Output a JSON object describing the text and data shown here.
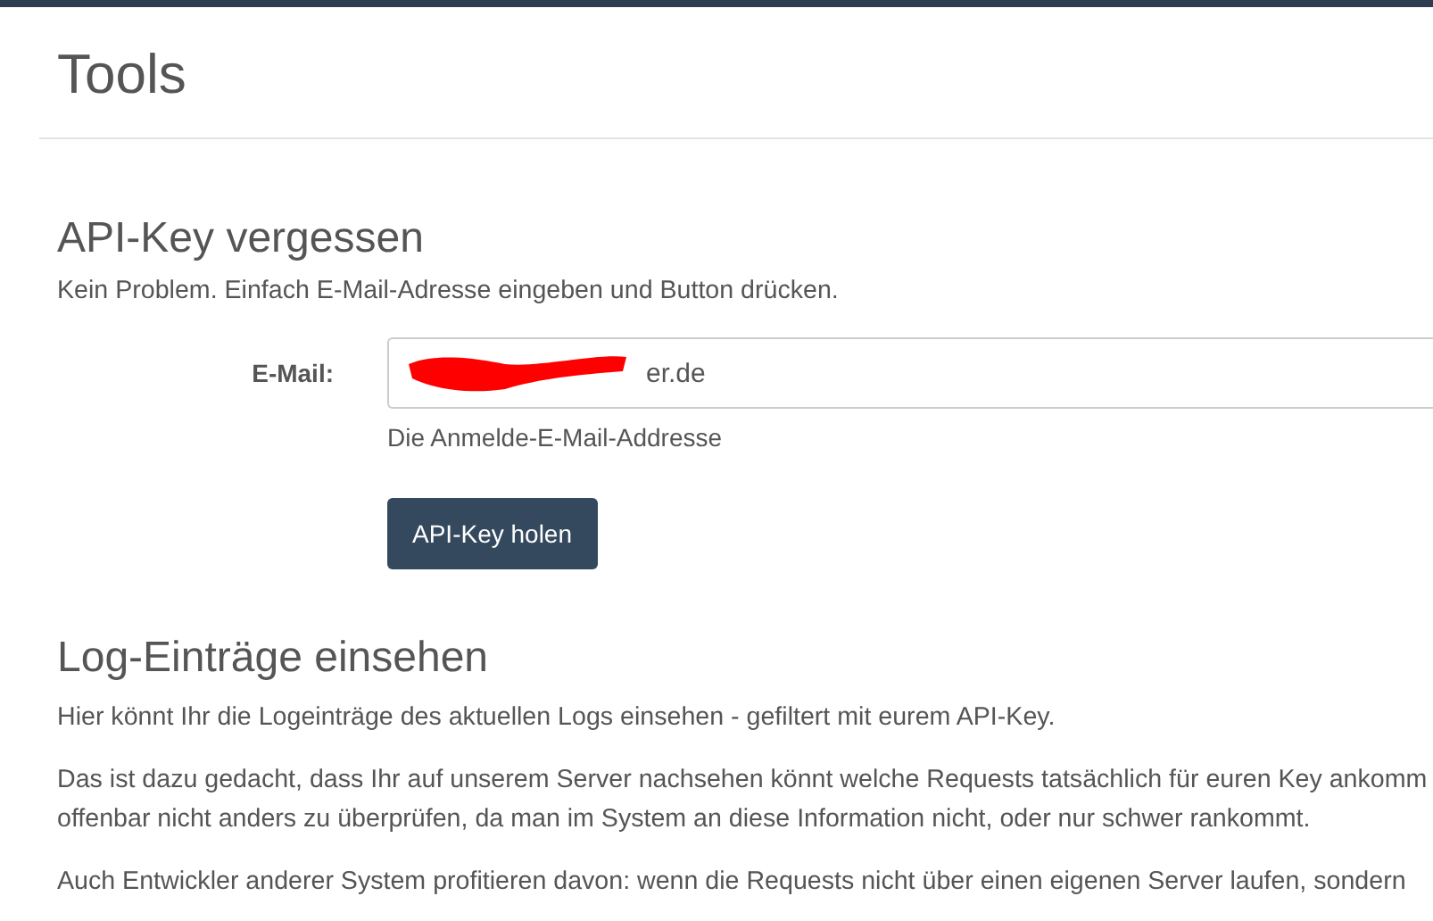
{
  "page_title": "Tools",
  "api_key_section": {
    "heading": "API-Key vergessen",
    "intro": "Kein Problem. Einfach E-Mail-Adresse eingeben und Button drücken.",
    "email_field": {
      "label": "E-Mail:",
      "value": "er.de",
      "help": "Die Anmelde-E-Mail-Addresse"
    },
    "button": "API-Key holen"
  },
  "log_section": {
    "heading": "Log-Einträge einsehen",
    "paragraphs": [
      {
        "lines": [
          "Hier könnt Ihr die Logeinträge des aktuellen Logs einsehen - gefiltert mit eurem API-Key."
        ]
      },
      {
        "lines": [
          "Das ist dazu gedacht, dass Ihr auf unserem Server nachsehen könnt welche Requests tatsächlich für euren Key ankomm",
          "offenbar nicht anders zu überprüfen, da man im System an diese Information nicht, oder nur schwer rankommt."
        ]
      },
      {
        "lines": [
          "Auch Entwickler anderer System profitieren davon: wenn die Requests nicht über einen eigenen Server laufen, sondern"
        ]
      }
    ]
  }
}
